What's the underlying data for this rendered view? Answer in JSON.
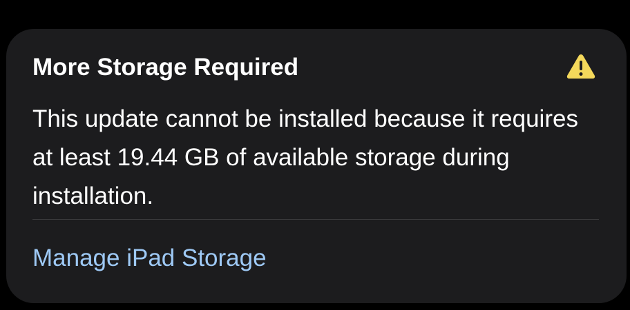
{
  "alert": {
    "title": "More Storage Required",
    "icon": "warning-triangle-icon",
    "icon_color": "#f4d85b",
    "message": "This update cannot be installed because it requires at least 19.44 GB of available storage during installation.",
    "action_label": "Manage iPad Storage",
    "action_color": "#9ec9f5"
  }
}
